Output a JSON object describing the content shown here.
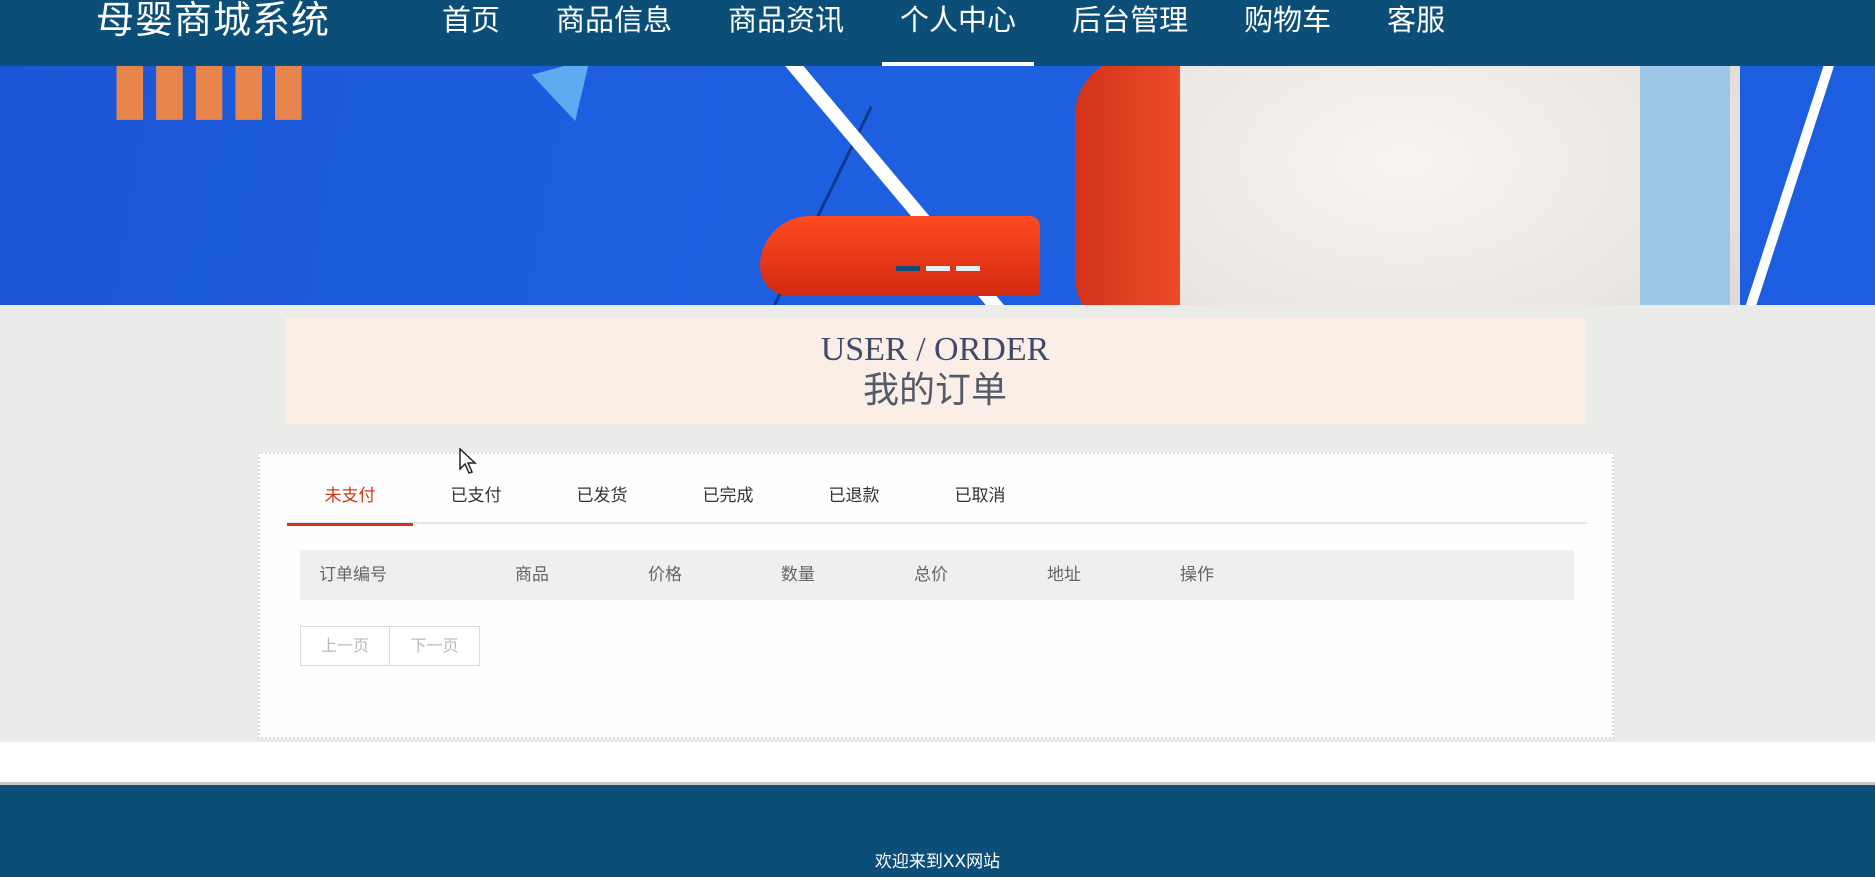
{
  "nav": {
    "brand": "母婴商城系统",
    "items": [
      {
        "label": "首页",
        "active": false
      },
      {
        "label": "商品信息",
        "active": false
      },
      {
        "label": "商品资讯",
        "active": false
      },
      {
        "label": "个人中心",
        "active": true
      },
      {
        "label": "后台管理",
        "active": false
      },
      {
        "label": "购物车",
        "active": false
      },
      {
        "label": "客服",
        "active": false
      }
    ]
  },
  "banner": {
    "slide_count": 3,
    "active_slide": 1
  },
  "title": {
    "en": "USER / ORDER",
    "cn": "我的订单"
  },
  "orders": {
    "tabs": [
      {
        "label": "未支付",
        "active": true
      },
      {
        "label": "已支付",
        "active": false
      },
      {
        "label": "已发货",
        "active": false
      },
      {
        "label": "已完成",
        "active": false
      },
      {
        "label": "已退款",
        "active": false
      },
      {
        "label": "已取消",
        "active": false
      }
    ],
    "columns": [
      "订单编号",
      "商品",
      "价格",
      "数量",
      "总价",
      "地址",
      "操作"
    ],
    "rows": [],
    "pager": {
      "prev": "上一页",
      "next": "下一页"
    }
  },
  "footer": {
    "text": "欢迎来到XX网站"
  },
  "colors": {
    "nav_bg": "#0b4f79",
    "accent": "#d2361a",
    "title_bg": "#fbeee6"
  }
}
